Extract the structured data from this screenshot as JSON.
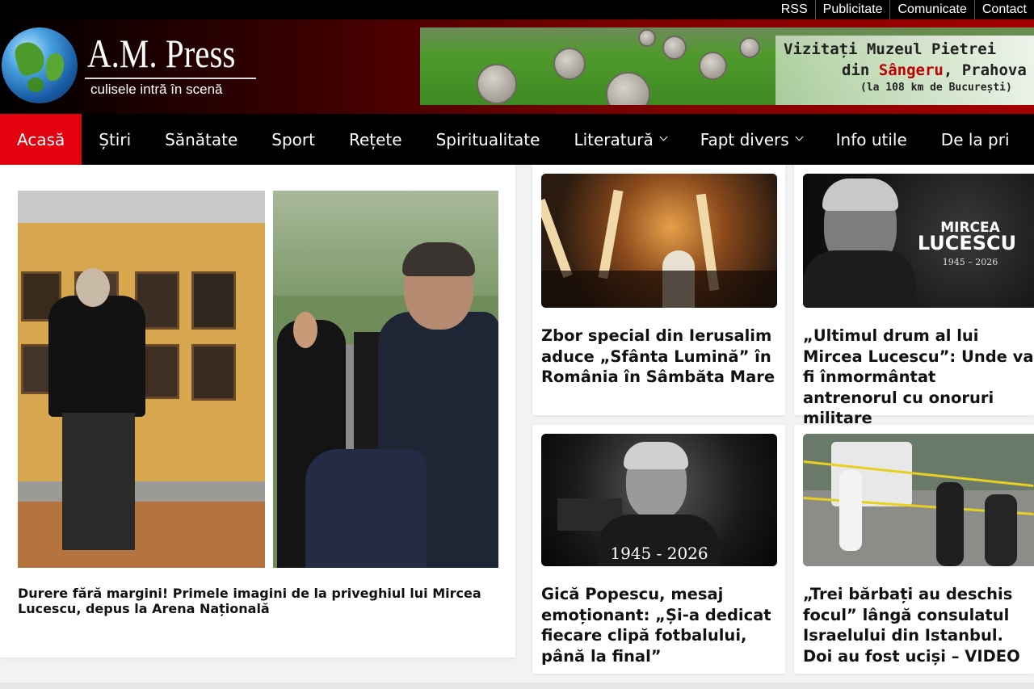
{
  "toplinks": [
    "RSS",
    "Publicitate",
    "Comunicate",
    "Contact"
  ],
  "brand": {
    "name": "A.M. Press",
    "tagline": "culisele intră în scenă"
  },
  "banner": {
    "line1": "Vizitați Muzeul Pietrei",
    "line2_pre": "din ",
    "line2_hl": "Sângeru",
    "line2_post": ", Prahova",
    "line3": "(la 108 km de București)"
  },
  "nav": [
    {
      "label": "Acasă",
      "active": true,
      "dropdown": false
    },
    {
      "label": "Știri",
      "active": false,
      "dropdown": false
    },
    {
      "label": "Sănătate",
      "active": false,
      "dropdown": false
    },
    {
      "label": "Sport",
      "active": false,
      "dropdown": false
    },
    {
      "label": "Rețete",
      "active": false,
      "dropdown": false
    },
    {
      "label": "Spiritualitate",
      "active": false,
      "dropdown": false
    },
    {
      "label": "Literatură",
      "active": false,
      "dropdown": true
    },
    {
      "label": "Fapt divers",
      "active": false,
      "dropdown": true
    },
    {
      "label": "Info utile",
      "active": false,
      "dropdown": false
    },
    {
      "label": "De la pri",
      "active": false,
      "dropdown": false
    }
  ],
  "articles": {
    "featured": {
      "title": "Durere fără margini! Primele imagini de la priveghiul lui Mircea Lucescu, depus la Arena Națională"
    },
    "a1": {
      "title": "Zbor special din Ierusalim aduce „Sfânta Lumină” în România în Sâmbăta Mare"
    },
    "a2": {
      "title": "„Ultimul drum al lui Mircea Lucescu”: Unde va fi înmormântat antrenorul cu onoruri militare",
      "img_title": "MIRCEA",
      "img_title2": "LUCESCU",
      "img_years": "1945 – 2026"
    },
    "a3": {
      "title": "Gică Popescu, mesaj emoționant: „Și-a dedicat fiecare clipă fotbalului, până la final”",
      "img_years": "1945 - 2026"
    },
    "a4": {
      "title": "„Trei bărbați au deschis focul” lângă consulatul Israelului din Istanbul. Doi au fost uciși – VIDEO"
    }
  },
  "colors": {
    "nav_active": "#e3000f",
    "header_dark": "#000000",
    "header_red": "#a30000"
  }
}
